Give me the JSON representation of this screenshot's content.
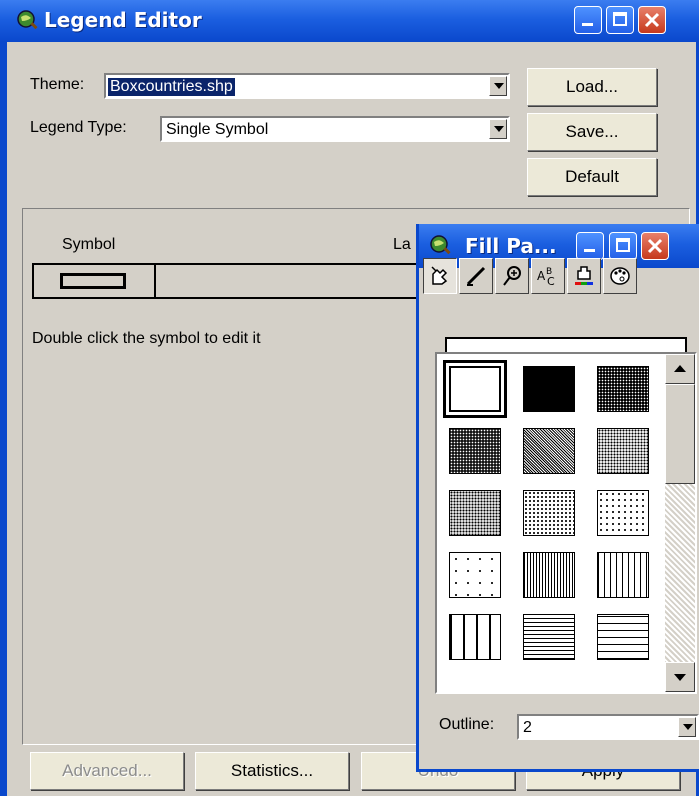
{
  "legend_editor": {
    "title": "Legend Editor",
    "theme_label": "Theme:",
    "theme_value": "Boxcountries.shp",
    "legend_type_label": "Legend Type:",
    "legend_type_value": "Single Symbol",
    "buttons": {
      "load": "Load...",
      "save": "Save...",
      "default": "Default",
      "advanced": "Advanced...",
      "statistics": "Statistics...",
      "undo": "Undo",
      "apply": "Apply"
    },
    "table": {
      "symbol_header": "Symbol",
      "label_header": "La"
    },
    "hint": "Double click the symbol to edit it"
  },
  "fill_palette": {
    "title": "Fill Pa...",
    "outline_label": "Outline:",
    "outline_value": "2",
    "tools": [
      "fill-palette-icon",
      "pen-palette-icon",
      "marker-palette-icon",
      "font-palette-icon",
      "color-palette-icon",
      "palette-manager-icon"
    ],
    "patterns": [
      "hollow",
      "solid",
      "dense-dots",
      "dense-dots-2",
      "medium-dots",
      "medium-dots-2",
      "light-dots",
      "sparse-dots",
      "sparser-dots",
      "very-sparse-dots",
      "dense-vertical-lines",
      "vertical-lines",
      "wide-vertical-lines",
      "horizontal-lines",
      "wide-horizontal-lines"
    ]
  },
  "colors": {
    "title_bar": "#0a48cc",
    "face": "#d4d0c8",
    "selection": "#0a246a"
  }
}
